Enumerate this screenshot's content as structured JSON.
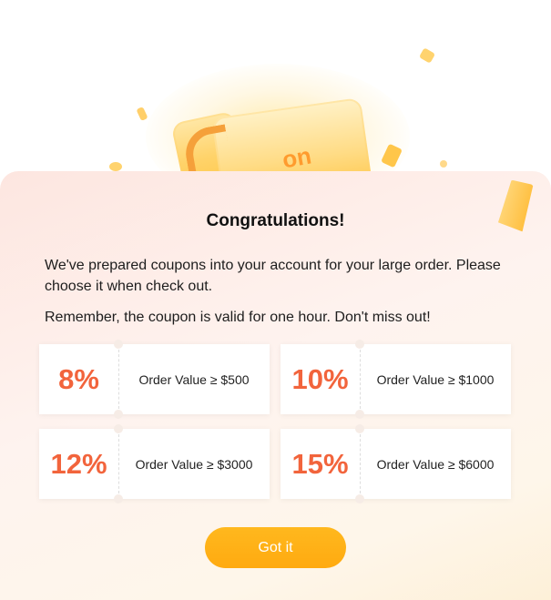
{
  "dialog": {
    "title": "Congratulations!",
    "message_1": "We've prepared coupons into your account for your large order. Please choose it when check out.",
    "message_2": "Remember, the coupon is valid for one hour. Don't miss out!",
    "coupons": [
      {
        "discount": "8%",
        "condition": "Order Value ≥ $500"
      },
      {
        "discount": "10%",
        "condition": "Order Value ≥ $1000"
      },
      {
        "discount": "12%",
        "condition": "Order Value ≥ $3000"
      },
      {
        "discount": "15%",
        "condition": "Order Value ≥ $6000"
      }
    ],
    "button_label": "Got it"
  },
  "hero": {
    "icon": "coupon-ticket-illustration",
    "ticket_text": "on"
  },
  "colors": {
    "accent": "#FFAA10",
    "discount": "#F2643C",
    "card_bg": "#FEF3EF"
  }
}
